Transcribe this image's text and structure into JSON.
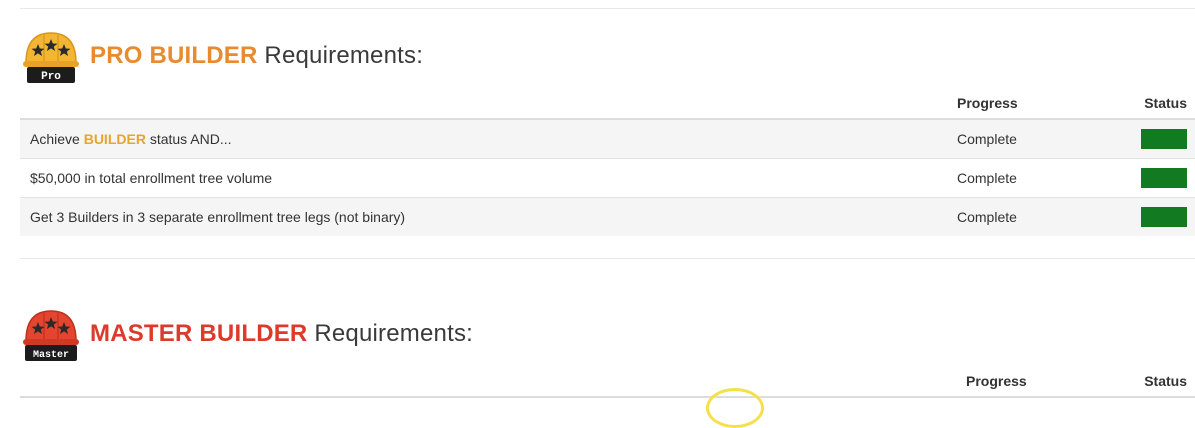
{
  "colors": {
    "pro_rank": "#e88a2d",
    "master_rank": "#dc3a2b",
    "builder_highlight": "#e8a52d",
    "status_complete": "#127a20"
  },
  "pro": {
    "rank": "PRO BUILDER",
    "title_suffix": "Requirements:",
    "badge_label": "Pro",
    "col_progress": "Progress",
    "col_status": "Status",
    "rows": [
      {
        "pre": "Achieve ",
        "highlight": "BUILDER",
        "post": " status AND...",
        "progress": "Complete",
        "status": "complete"
      },
      {
        "pre": "$50,000 in total enrollment tree volume",
        "highlight": "",
        "post": "",
        "progress": "Complete",
        "status": "complete"
      },
      {
        "pre": "Get 3 Builders in 3 separate enrollment tree legs (not binary)",
        "highlight": "",
        "post": "",
        "progress": "Complete",
        "status": "complete"
      }
    ]
  },
  "master": {
    "rank": "MASTER BUILDER",
    "title_suffix": "Requirements:",
    "badge_label": "Master",
    "col_progress": "Progress",
    "col_status": "Status"
  }
}
